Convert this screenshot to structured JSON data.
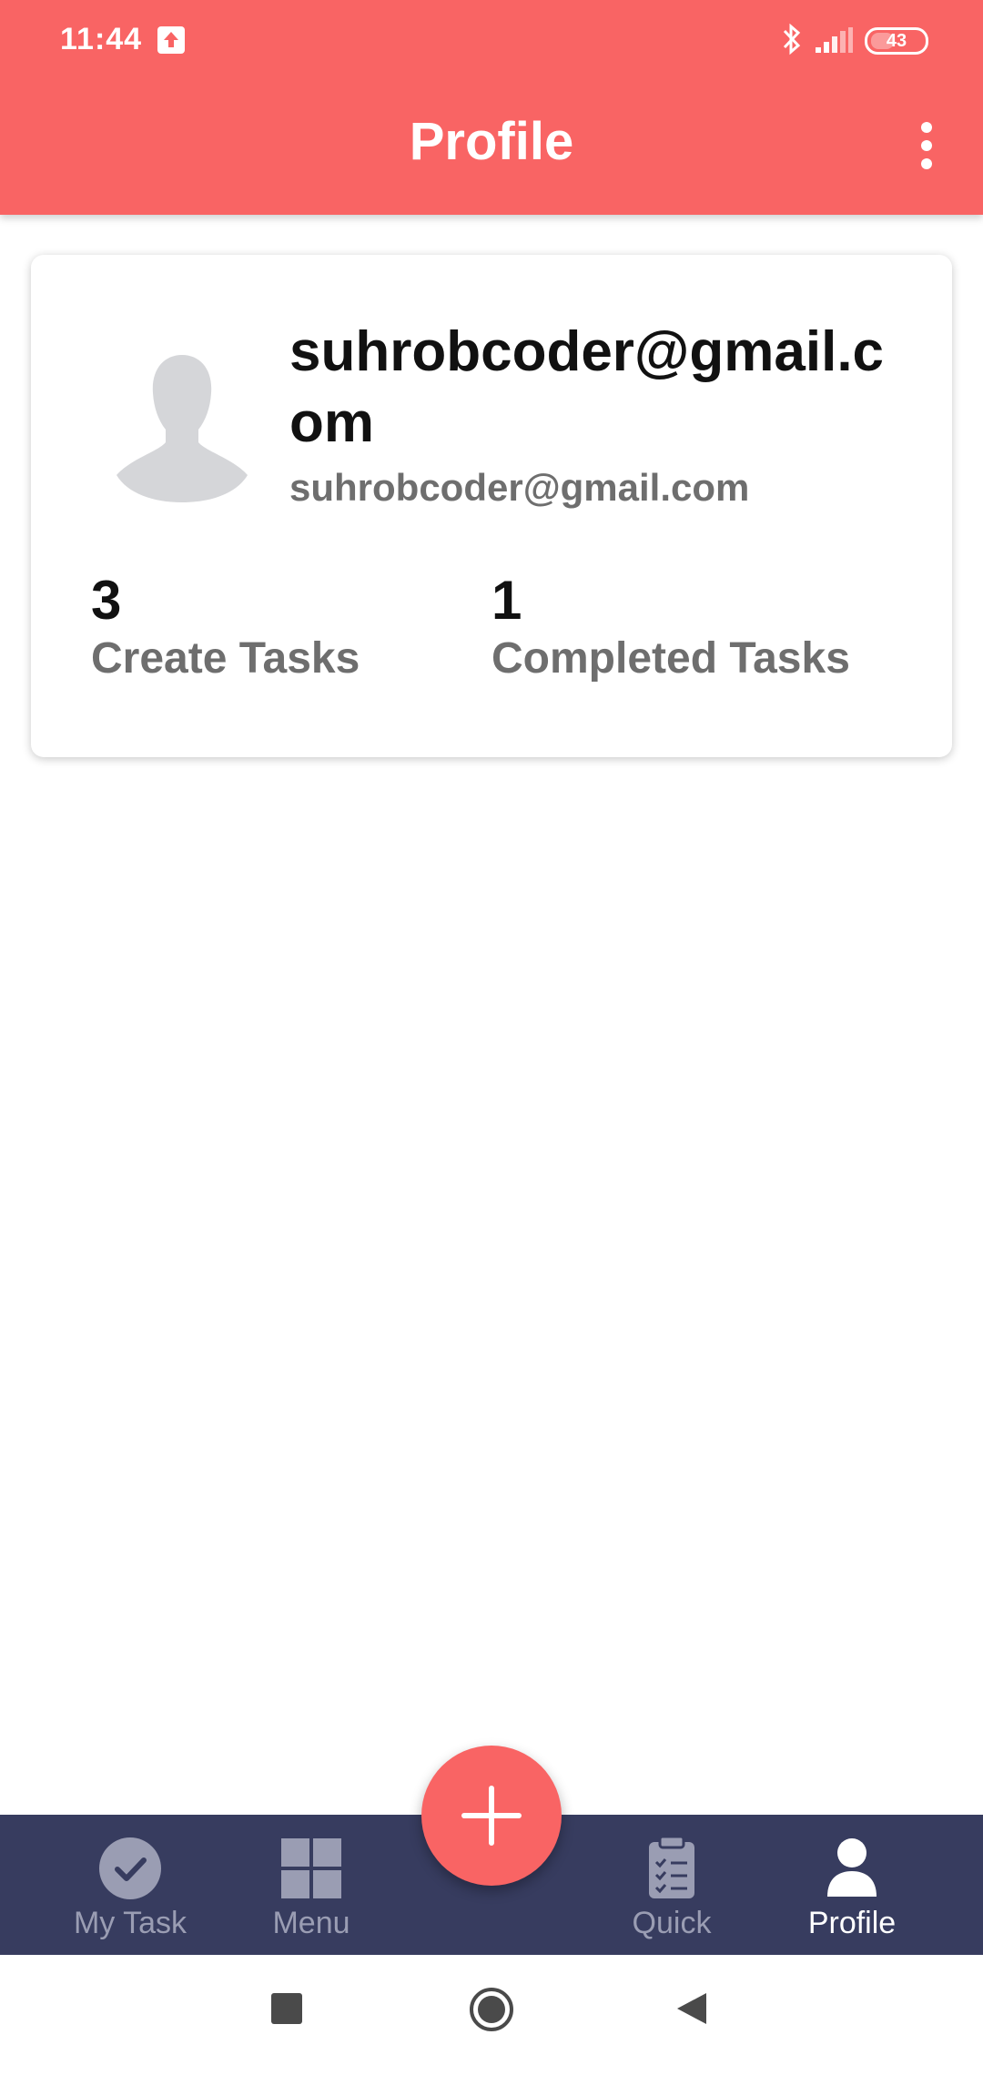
{
  "status_bar": {
    "time": "11:44",
    "battery": "43",
    "battery_level_percent": 43,
    "icons": [
      "upload-icon",
      "bluetooth-icon",
      "signal-icon",
      "battery-icon"
    ]
  },
  "app_bar": {
    "title": "Profile",
    "menu_icon": "more-vert-icon"
  },
  "profile": {
    "display_name": "suhrobcoder@gmail.com",
    "email": "suhrobcoder@gmail.com",
    "avatar_icon": "person-silhouette-icon",
    "stats": [
      {
        "count": "3",
        "label": "Create Tasks"
      },
      {
        "count": "1",
        "label": "Completed Tasks"
      }
    ]
  },
  "bottom_nav": {
    "items": [
      {
        "label": "My Task",
        "icon": "check-circle-icon",
        "active": false
      },
      {
        "label": "Menu",
        "icon": "grid-icon",
        "active": false
      },
      {
        "label": "Quick",
        "icon": "clipboard-list-icon",
        "active": false
      },
      {
        "label": "Profile",
        "icon": "person-icon",
        "active": true
      }
    ],
    "fab_icon": "plus-icon"
  },
  "system_nav": {
    "icons": [
      "recents-square-icon",
      "home-circle-icon",
      "back-triangle-icon"
    ]
  },
  "colors": {
    "accent": "#f96464",
    "nav_background": "#373c5f",
    "nav_inactive": "#9a9db3",
    "text_primary": "#111111",
    "text_secondary": "#6e6e6e"
  }
}
